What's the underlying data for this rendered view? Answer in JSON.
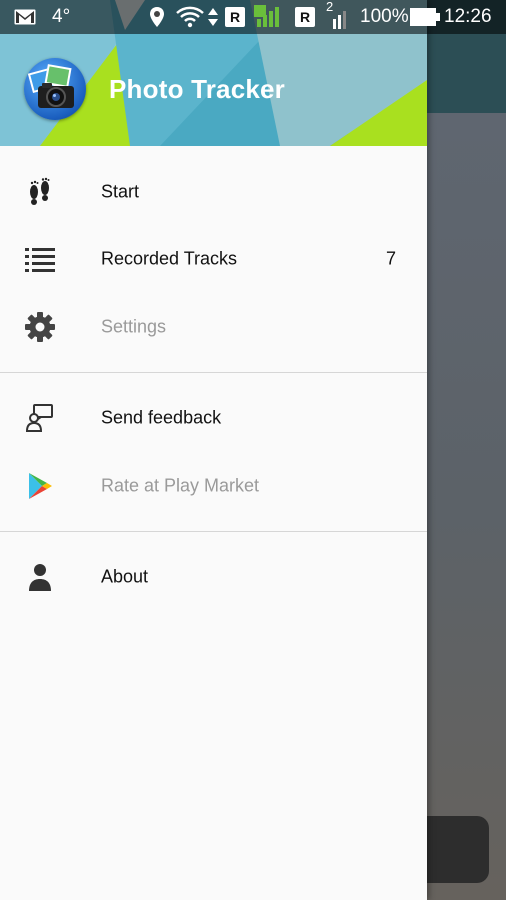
{
  "status_bar": {
    "temperature": "4°",
    "roaming_badge_1": "R",
    "roaming_badge_2": "R",
    "sim_slot": "2",
    "battery": "100%",
    "time": "12:26"
  },
  "drawer": {
    "title": "Photo Tracker",
    "groups": [
      {
        "items": [
          {
            "label": "Start",
            "icon": "footprints-icon",
            "enabled": true
          },
          {
            "label": "Recorded Tracks",
            "icon": "list-icon",
            "enabled": true,
            "count": "7"
          },
          {
            "label": "Settings",
            "icon": "gear-icon",
            "enabled": false
          }
        ]
      },
      {
        "items": [
          {
            "label": "Send feedback",
            "icon": "feedback-icon",
            "enabled": true
          },
          {
            "label": "Rate at Play Market",
            "icon": "play-store-icon",
            "enabled": false
          }
        ]
      },
      {
        "items": [
          {
            "label": "About",
            "icon": "person-icon",
            "enabled": true
          }
        ]
      }
    ]
  },
  "colors": {
    "header_blue": "#7fc6d8",
    "header_green": "#a9e01f",
    "drawer_bg": "#fafafa",
    "disabled_text": "#9a9a9a",
    "appbar_behind": "#2c4e55"
  }
}
